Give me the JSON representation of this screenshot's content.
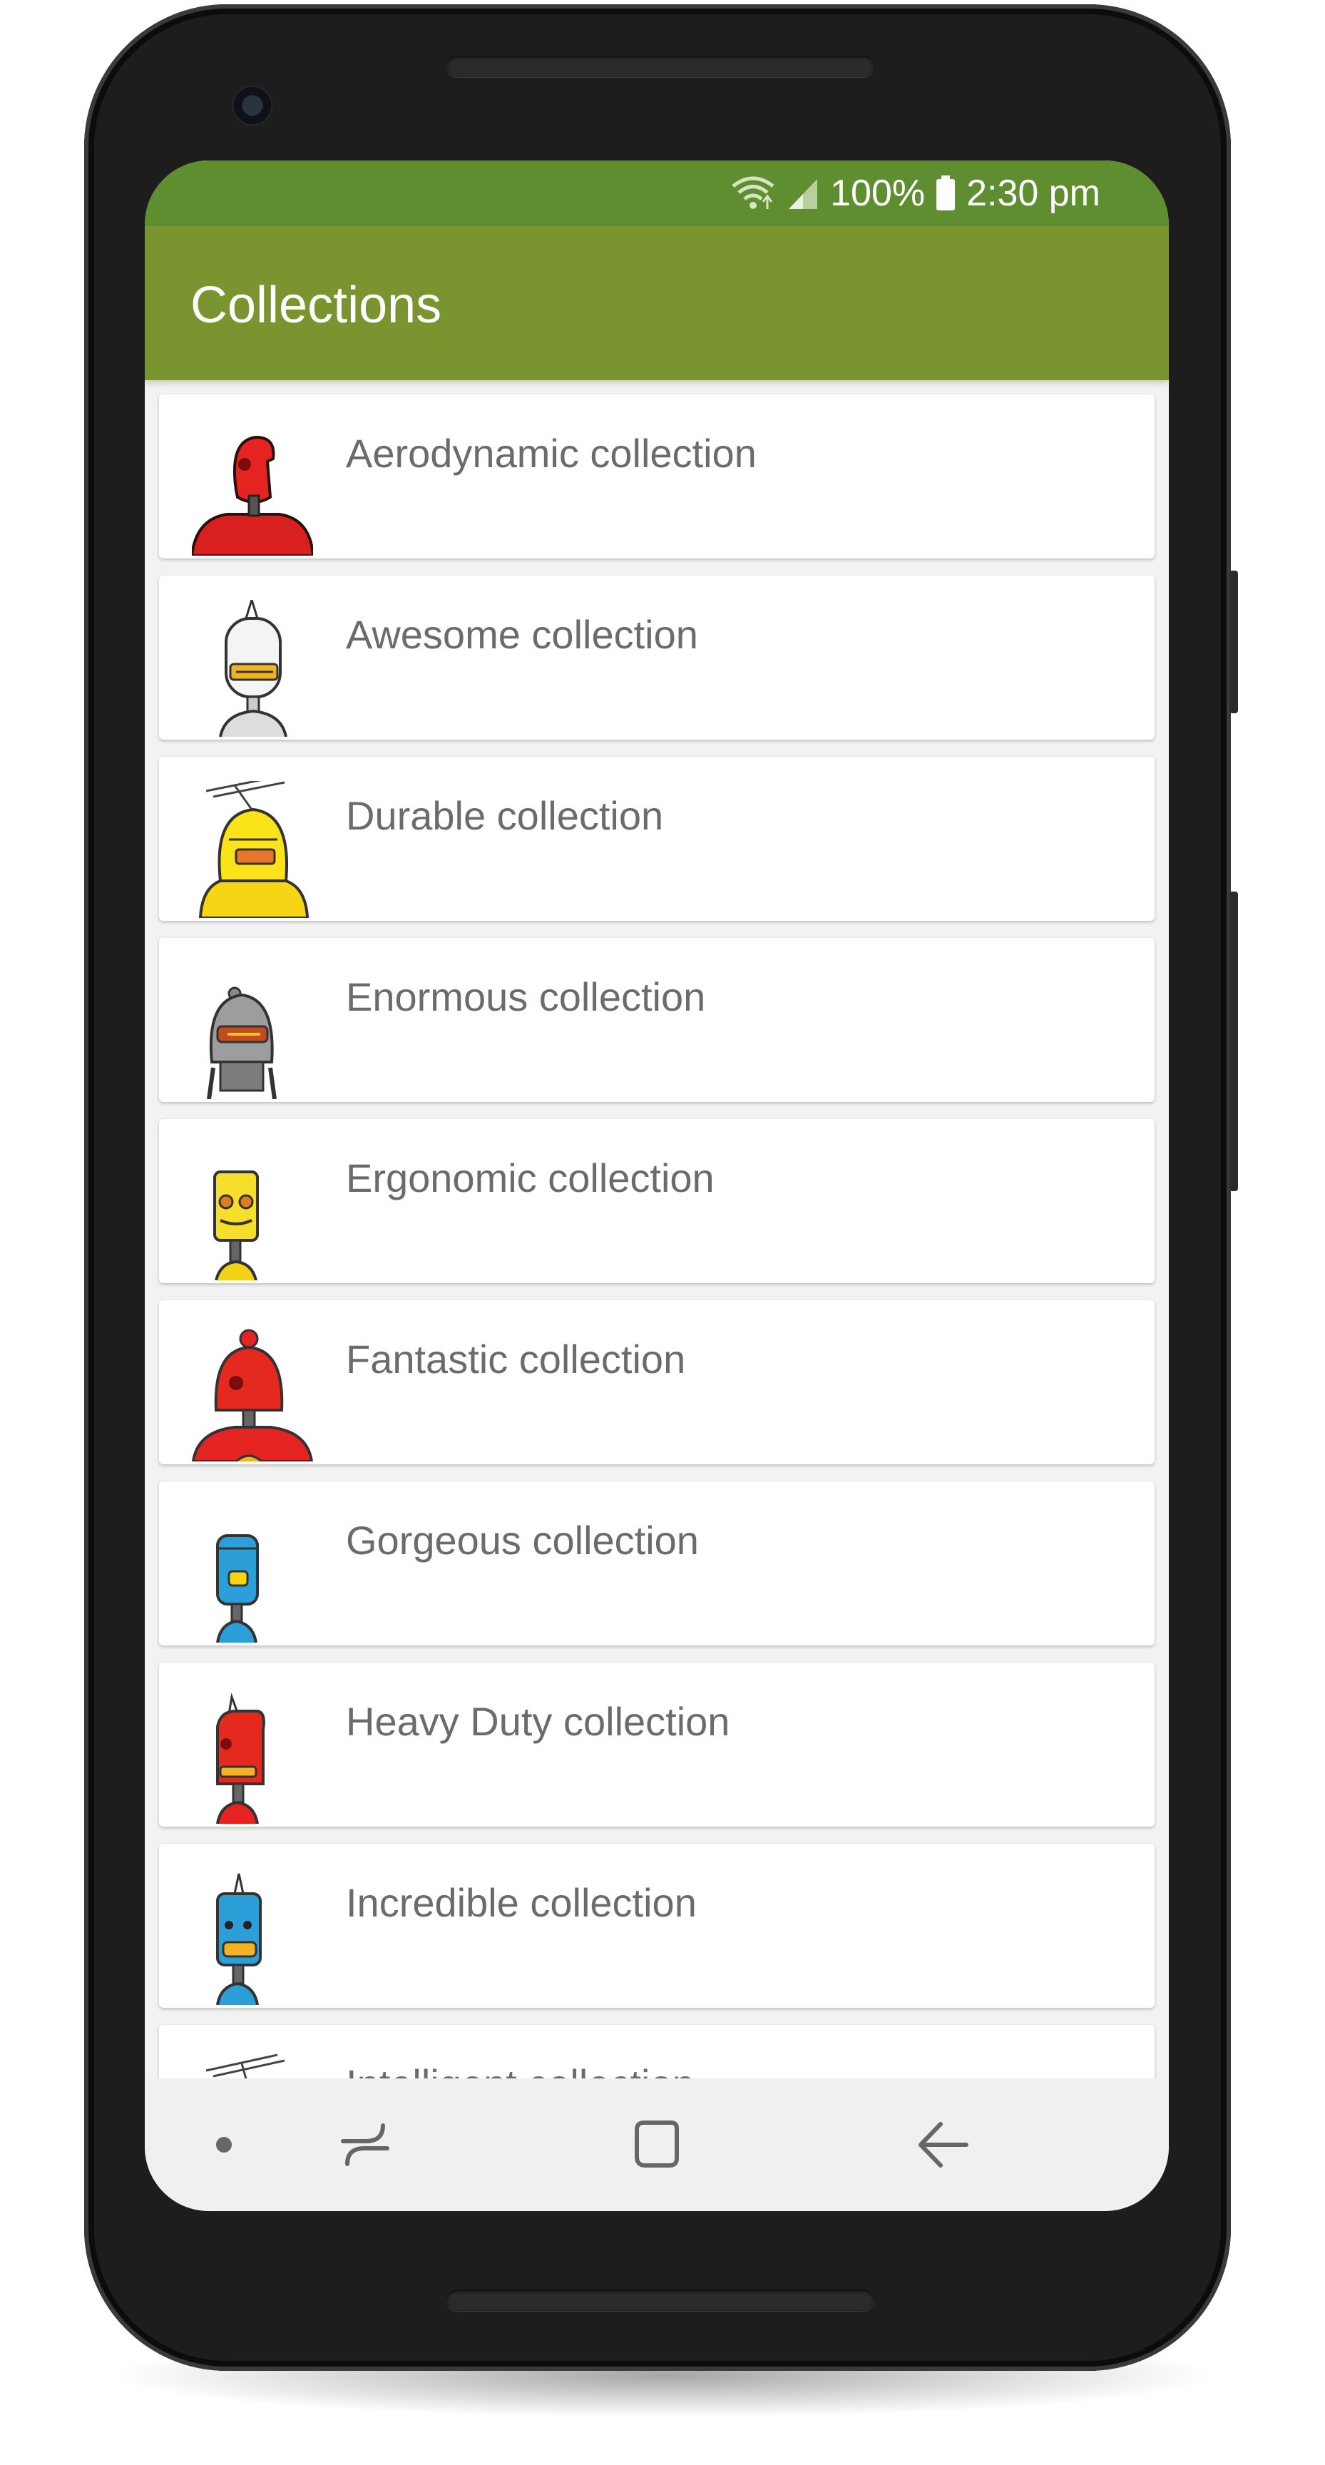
{
  "status_bar": {
    "battery": "100%",
    "time": "2:30 pm",
    "icons": [
      "wifi-icon",
      "signal-icon",
      "battery-icon"
    ]
  },
  "app_bar": {
    "title": "Collections",
    "color": "#7a9430",
    "status_color": "#5e8e2f"
  },
  "collections": [
    {
      "label": "Aerodynamic collection",
      "robot": "red-robot"
    },
    {
      "label": "Awesome collection",
      "robot": "white-robot"
    },
    {
      "label": "Durable collection",
      "robot": "yellow-robot"
    },
    {
      "label": "Enormous collection",
      "robot": "grey-robot"
    },
    {
      "label": "Ergonomic collection",
      "robot": "yellow-robot"
    },
    {
      "label": "Fantastic collection",
      "robot": "red-robot"
    },
    {
      "label": "Gorgeous collection",
      "robot": "blue-robot"
    },
    {
      "label": "Heavy Duty collection",
      "robot": "red-robot"
    },
    {
      "label": "Incredible collection",
      "robot": "blue-robot"
    },
    {
      "label": "Intelligent collection",
      "robot": "red-robot"
    }
  ],
  "nav_bar": {
    "items": [
      "dot-icon",
      "recent-apps-icon",
      "home-icon",
      "back-icon"
    ]
  }
}
